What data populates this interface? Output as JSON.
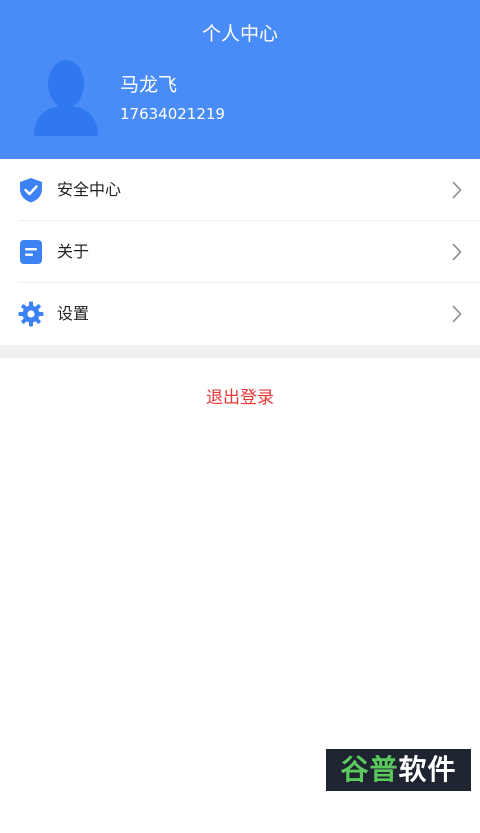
{
  "header": {
    "title": "个人中心",
    "user_name": "马龙飞",
    "phone": "17634021219"
  },
  "menu": {
    "items": [
      {
        "label": "安全中心",
        "icon": "shield-check-icon"
      },
      {
        "label": "关于",
        "icon": "document-icon"
      },
      {
        "label": "设置",
        "icon": "gear-icon"
      }
    ]
  },
  "logout": {
    "label": "退出登录"
  },
  "watermark": {
    "accent": "谷普",
    "text": "软件园"
  },
  "colors": {
    "header_bg": "#4a8cf7",
    "icon_blue": "#3d82f3",
    "logout_red": "#e53935"
  }
}
